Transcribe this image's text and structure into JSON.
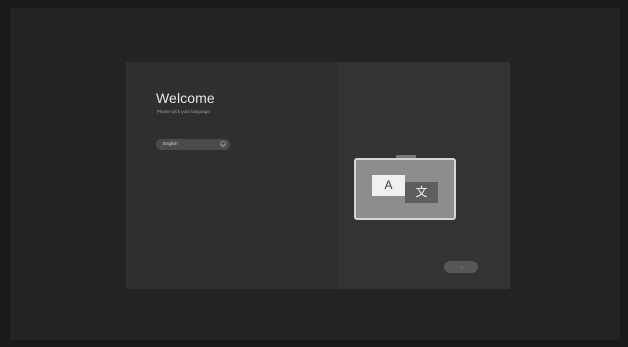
{
  "welcome": {
    "title": "Welcome",
    "subtitle": "Please pick your language"
  },
  "language_select": {
    "selected": "English"
  },
  "illustration": {
    "glyph_latin": "A",
    "glyph_cjk": "文"
  },
  "next_button": {
    "label": "→"
  }
}
